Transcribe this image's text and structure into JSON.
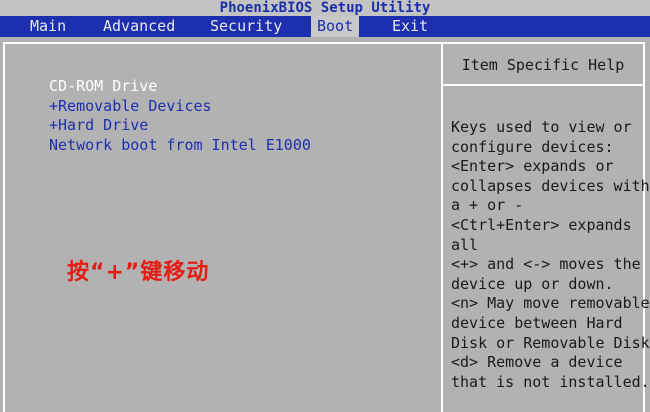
{
  "title": "PhoenixBIOS Setup Utility",
  "menu": [
    {
      "label": "Main"
    },
    {
      "label": "Advanced"
    },
    {
      "label": "Security"
    },
    {
      "label": "Boot"
    },
    {
      "label": "Exit"
    }
  ],
  "active_menu": "Boot",
  "boot_items": [
    {
      "label": "CD-ROM Drive"
    },
    {
      "label": "+Removable Devices"
    },
    {
      "label": "+Hard Drive"
    },
    {
      "label": "Network boot from Intel E1000"
    }
  ],
  "selected_boot_item": "CD-ROM Drive",
  "annotation": "按“+”键移动",
  "help": {
    "title": "Item Specific Help",
    "lines": [
      "Keys used to view or",
      "configure devices:",
      "<Enter> expands or",
      "collapses devices with",
      "a + or -",
      "<Ctrl+Enter> expands",
      "all",
      "<+> and <-> moves the",
      "device up or down.",
      "<n> May move removable",
      "device between Hard",
      "Disk or Removable Disk",
      "<d> Remove a device",
      "that is not installed."
    ]
  },
  "colors": {
    "background": "#b2b2b2",
    "menubar": "#1c2fae",
    "item_text": "#1c2fae",
    "selected_text": "#ffffff",
    "annotation": "#e51c14"
  }
}
